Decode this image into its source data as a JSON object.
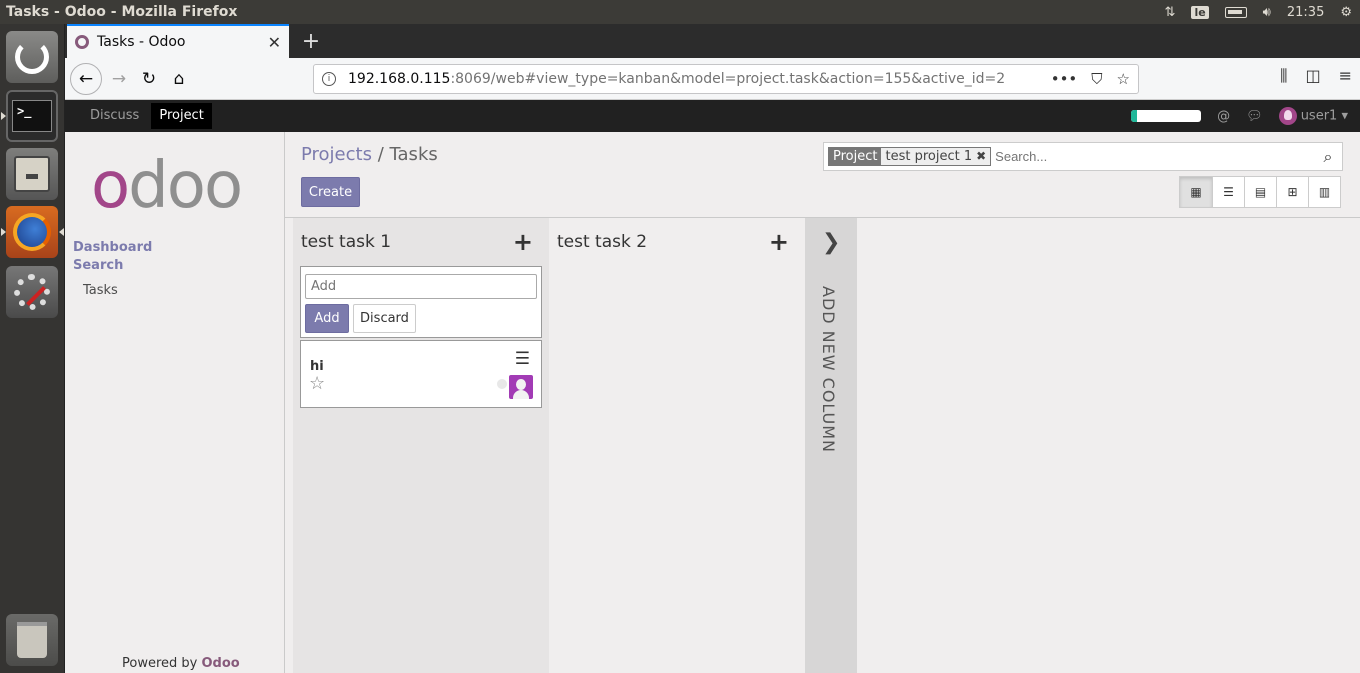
{
  "os": {
    "window_title": "Tasks - Odoo - Mozilla Firefox",
    "keyboard_layout": "le",
    "clock": "21:35"
  },
  "browser": {
    "tab_title": "Tasks - Odoo",
    "url_host": "192.168.0.115",
    "url_rest": ":8069/web#view_type=kanban&model=project.task&action=155&active_id=2"
  },
  "odoo": {
    "menu": [
      "Discuss",
      "Project"
    ],
    "user": "user1",
    "progress_fraction": 0.08,
    "accent": "#7c7bad",
    "sidebar": {
      "categories": [
        "Dashboard",
        "Search"
      ],
      "items": [
        "Tasks"
      ],
      "powered_by": "Powered by",
      "powered_brand": "Odoo"
    },
    "breadcrumb": {
      "parent": "Projects",
      "separator": "/",
      "current": "Tasks"
    },
    "create_label": "Create",
    "search": {
      "facet_label": "Project",
      "facet_value": "test project 1",
      "placeholder": "Search..."
    },
    "views": [
      "kanban-icon",
      "list-icon",
      "calendar-icon",
      "pivot-icon",
      "graph-icon"
    ],
    "kanban": {
      "columns": [
        {
          "title": "test task 1"
        },
        {
          "title": "test task 2"
        }
      ],
      "quick_create": {
        "placeholder": "Add",
        "add_label": "Add",
        "discard_label": "Discard"
      },
      "card": {
        "name": "hi"
      },
      "add_column_label": "ADD NEW COLUMN"
    }
  }
}
